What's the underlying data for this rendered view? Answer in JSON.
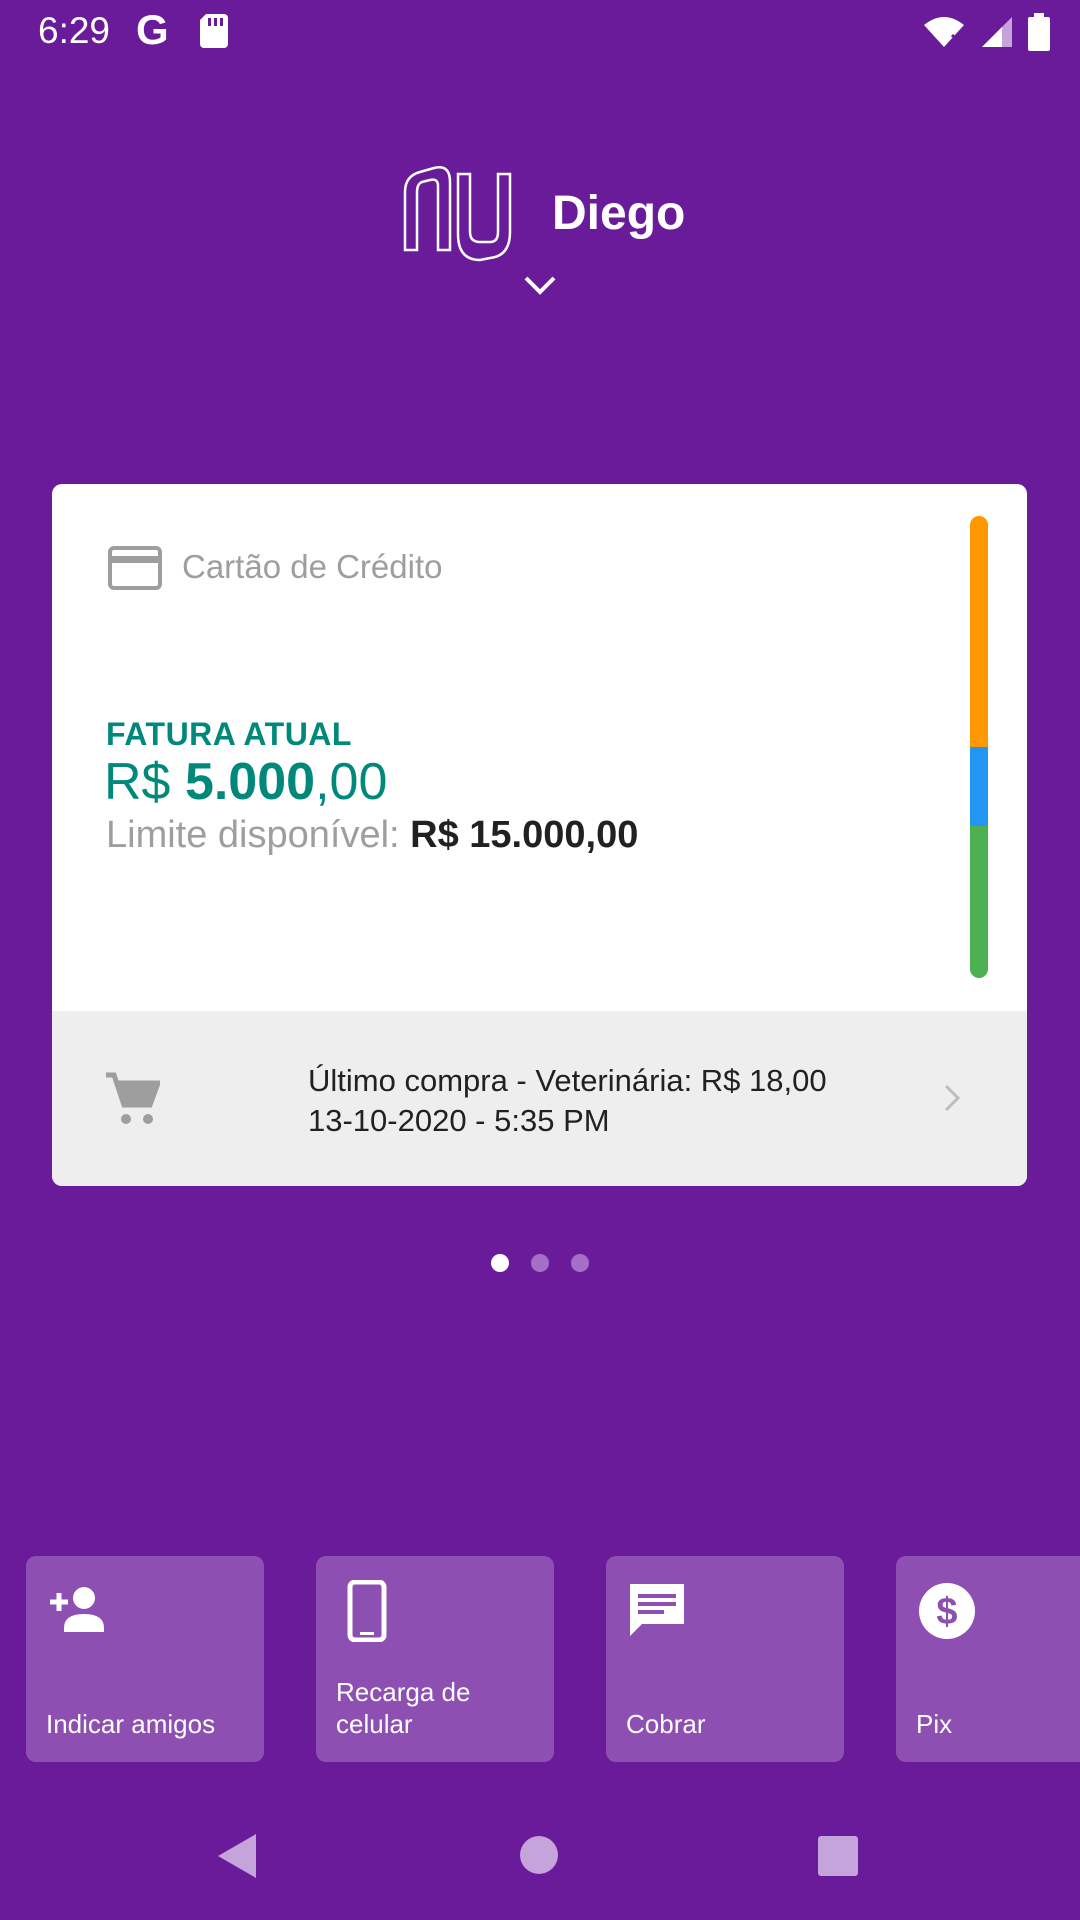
{
  "status_bar": {
    "time": "6:29",
    "google_glyph": "G",
    "icons": [
      "google-icon",
      "sd-card-icon",
      "wifi-icon",
      "signal-icon",
      "battery-icon"
    ]
  },
  "header": {
    "logo": "nu",
    "user_name": "Diego"
  },
  "card": {
    "type_label": "Cartão de Crédito",
    "fatura_title": "FATURA ATUAL",
    "fatura_currency": "R$",
    "fatura_int": "5.000",
    "fatura_dec": ",00",
    "limite_label": "Limite disponível:",
    "limite_value": "R$ 15.000,00",
    "bar_colors": {
      "orange": "#ff9800",
      "blue": "#2196f3",
      "green": "#4caf50"
    },
    "last_purchase_line1": "Último compra - Veterinária: R$ 18,00",
    "last_purchase_line2": "13-10-2020 - 5:35 PM"
  },
  "pager": {
    "count": 3,
    "active_index": 0
  },
  "shortcuts": [
    {
      "label": "Indicar amigos",
      "icon": "add-person-icon"
    },
    {
      "label": "Recarga de celular",
      "icon": "smartphone-icon"
    },
    {
      "label": "Cobrar",
      "icon": "message-icon"
    },
    {
      "label": "Pix",
      "icon": "dollar-circle-icon"
    }
  ],
  "colors": {
    "background": "#6a1b9a",
    "tile": "#8e4fb3",
    "accent": "#00897b"
  }
}
